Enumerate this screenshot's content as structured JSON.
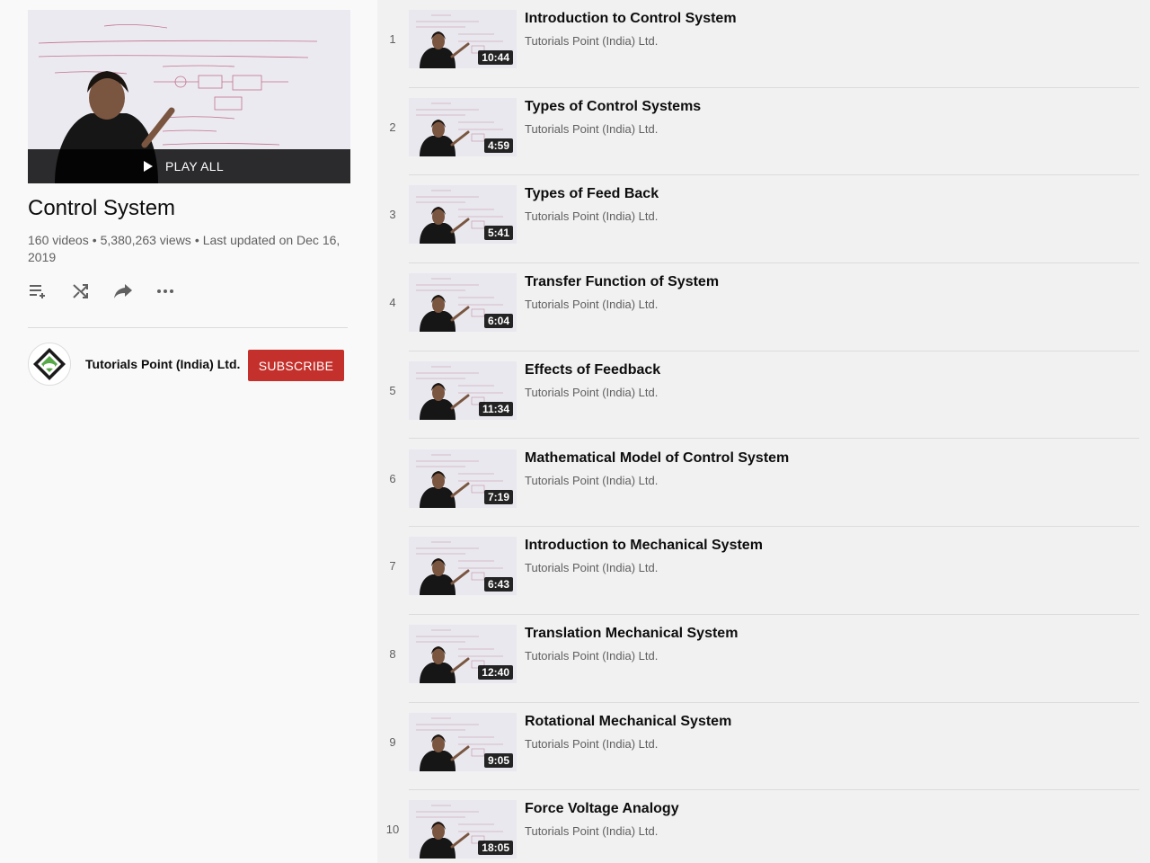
{
  "playlist": {
    "play_all_label": "PLAY ALL",
    "title": "Control System",
    "video_count": "160 videos",
    "views": "5,380,263 views",
    "last_updated": "Last updated on Dec 16, 2019"
  },
  "actions": {
    "icons": [
      "add-to-queue-icon",
      "shuffle-icon",
      "share-icon",
      "more-icon"
    ]
  },
  "owner": {
    "name": "Tutorials Point (India) Ltd.",
    "subscribe_label": "SUBSCRIBE"
  },
  "colors": {
    "subscribe_bg": "#c4302b",
    "sidebar_bg": "#f9f9f9",
    "list_bg": "#f1f1f1"
  },
  "videos": [
    {
      "index": "1",
      "title": "Introduction to Control System",
      "channel": "Tutorials Point (India) Ltd.",
      "duration": "10:44"
    },
    {
      "index": "2",
      "title": "Types of Control Systems",
      "channel": "Tutorials Point (India) Ltd.",
      "duration": "4:59"
    },
    {
      "index": "3",
      "title": "Types of Feed Back",
      "channel": "Tutorials Point (India) Ltd.",
      "duration": "5:41"
    },
    {
      "index": "4",
      "title": "Transfer Function of System",
      "channel": "Tutorials Point (India) Ltd.",
      "duration": "6:04"
    },
    {
      "index": "5",
      "title": "Effects of Feedback",
      "channel": "Tutorials Point (India) Ltd.",
      "duration": "11:34"
    },
    {
      "index": "6",
      "title": "Mathematical Model of Control System",
      "channel": "Tutorials Point (India) Ltd.",
      "duration": "7:19"
    },
    {
      "index": "7",
      "title": "Introduction to Mechanical System",
      "channel": "Tutorials Point (India) Ltd.",
      "duration": "6:43"
    },
    {
      "index": "8",
      "title": "Translation Mechanical System",
      "channel": "Tutorials Point (India) Ltd.",
      "duration": "12:40"
    },
    {
      "index": "9",
      "title": "Rotational Mechanical System",
      "channel": "Tutorials Point (India) Ltd.",
      "duration": "9:05"
    },
    {
      "index": "10",
      "title": "Force Voltage Analogy",
      "channel": "Tutorials Point (India) Ltd.",
      "duration": "18:05"
    }
  ]
}
